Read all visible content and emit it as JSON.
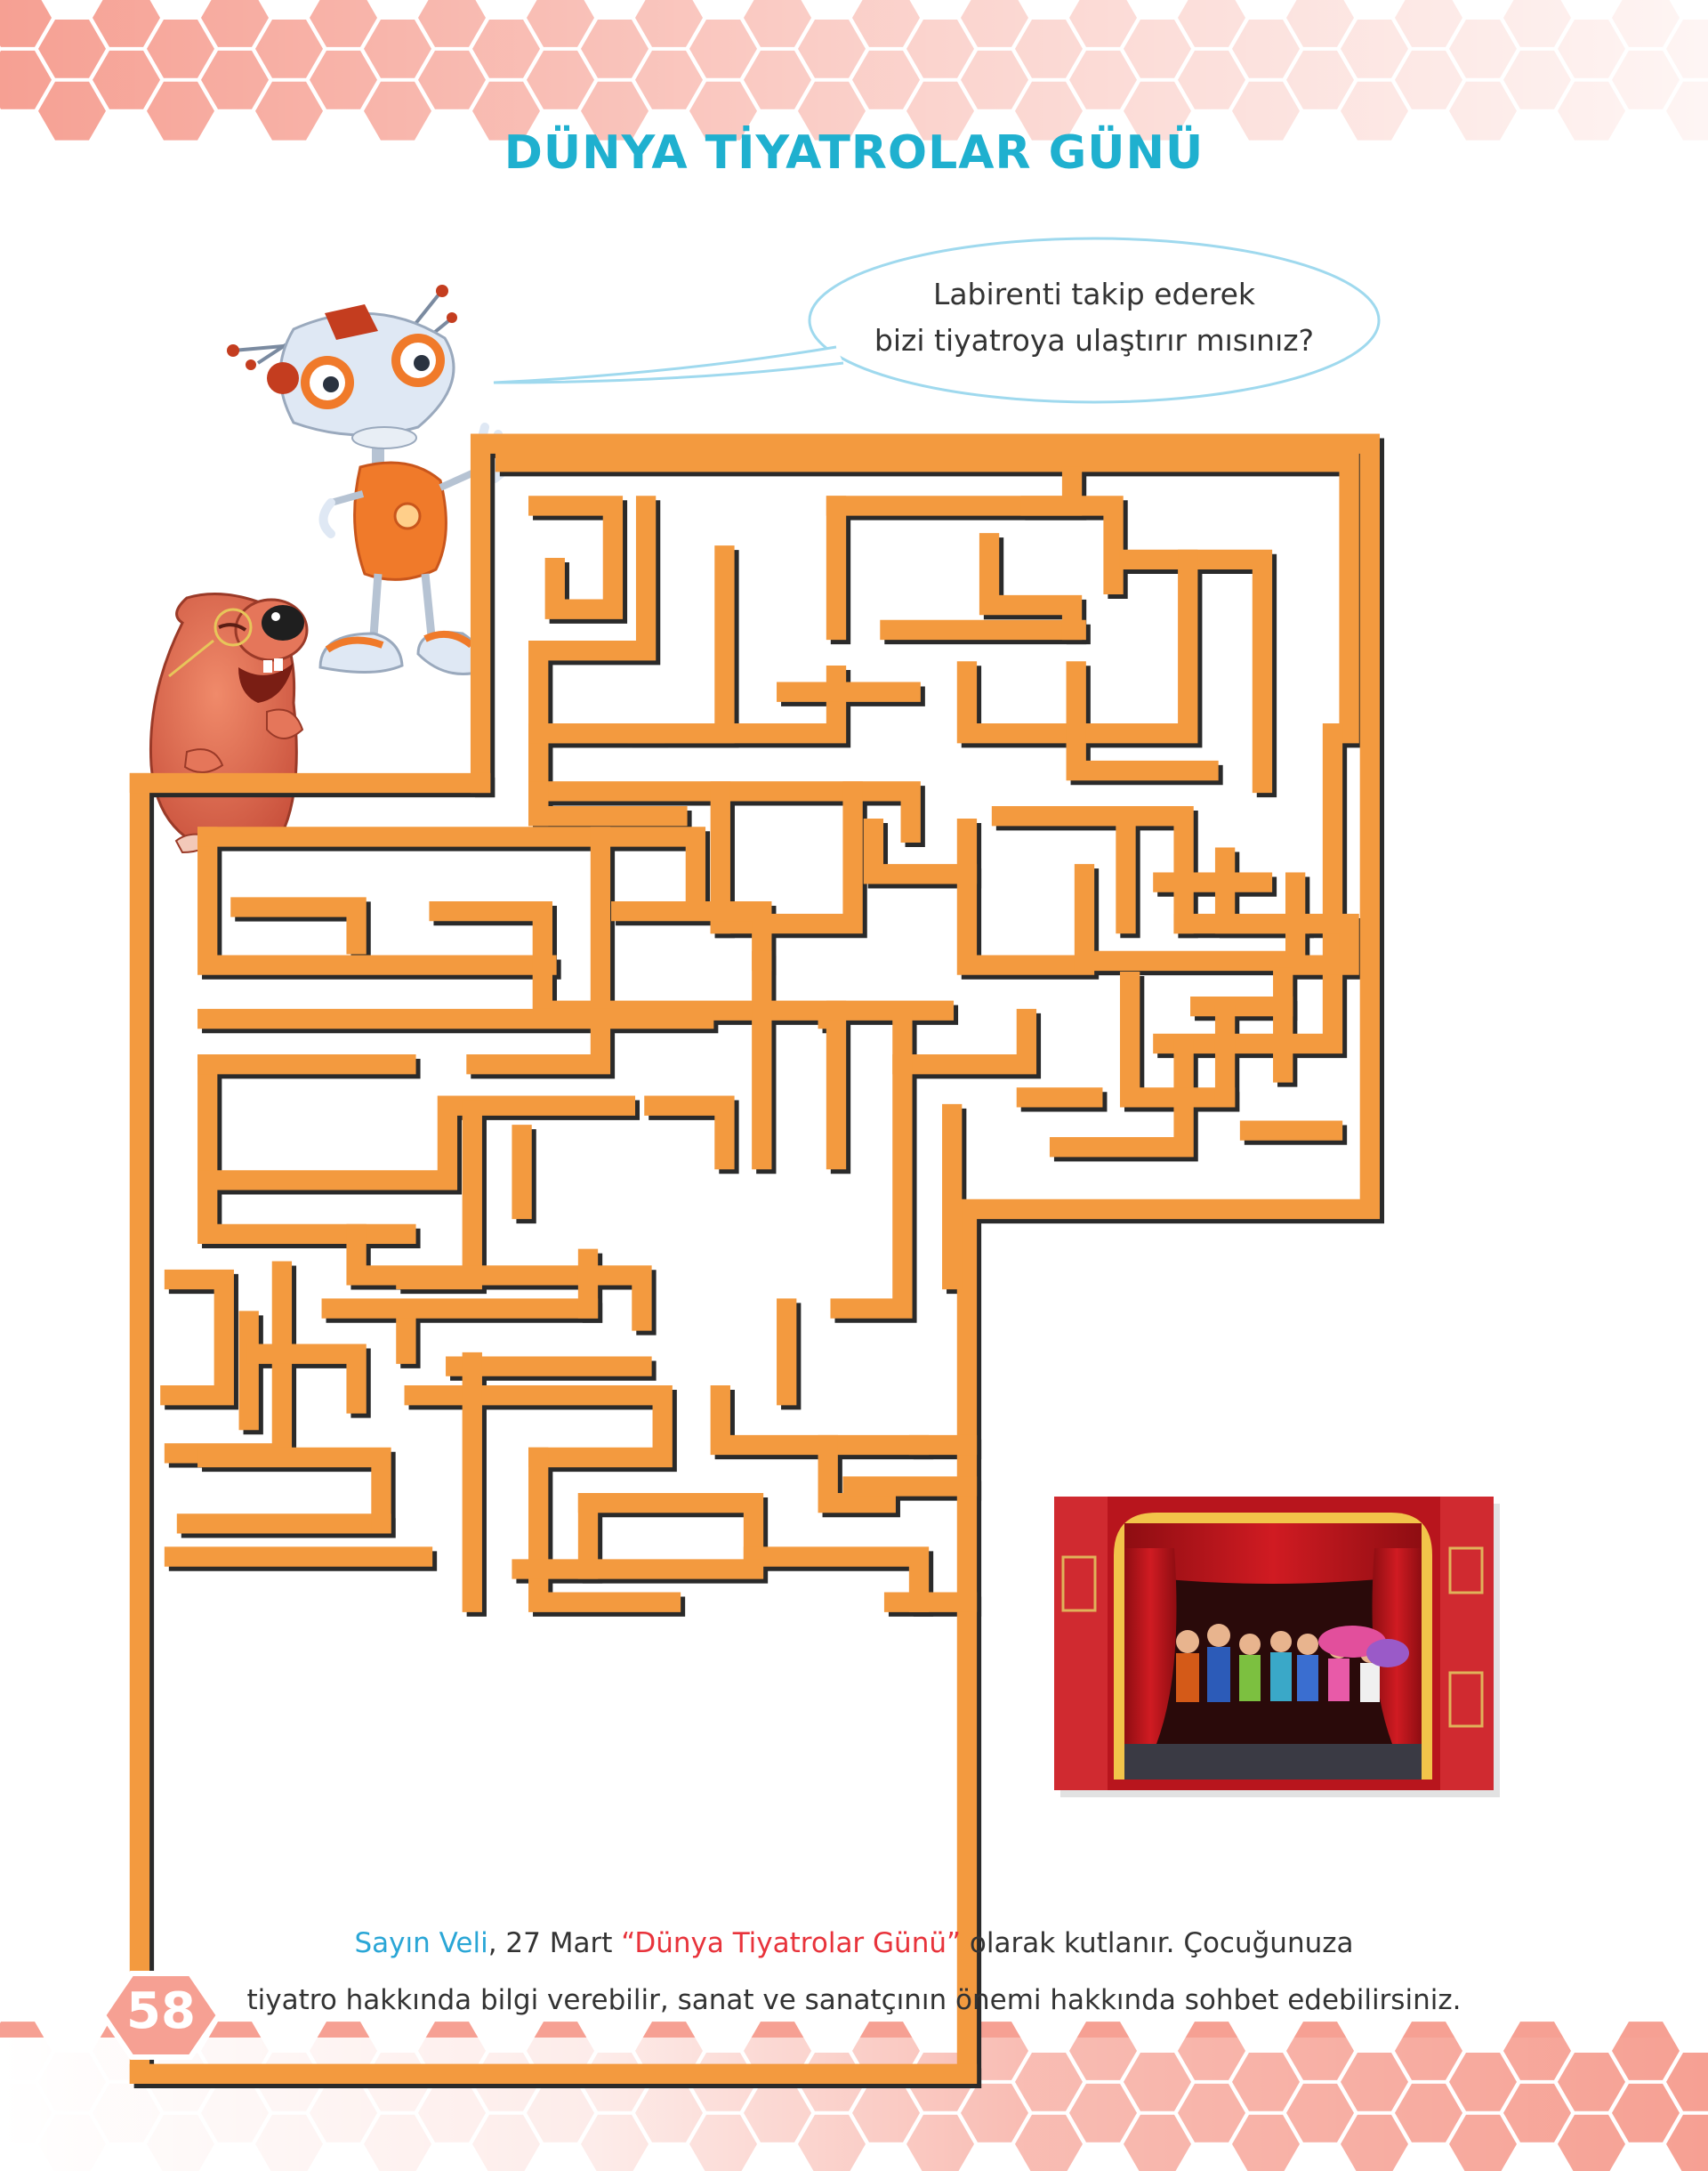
{
  "page": {
    "title": "DÜNYA TİYATROLAR GÜNÜ",
    "page_number": "58"
  },
  "speech_bubble": {
    "line1": "Labirenti takip ederek",
    "line2": "bizi tiyatroya ulaştırır mısınız?"
  },
  "parent_note": {
    "greeting": "Sayın Veli",
    "text1": ", 27 Mart ",
    "event": "“Dünya Tiyatrolar Günü”",
    "text2": " olarak kutlanır. Çocuğunuza",
    "line2": "tiyatro hakkında bilgi verebilir, sanat ve sanatçının önemi hakkında sohbet edebilirsiniz."
  },
  "colors": {
    "title": "#1fb0cf",
    "maze_wall": "#f39a3f",
    "hexagon": "#f6a093",
    "greeting": "#2aa6d6",
    "event": "#e8333b"
  },
  "icons": [
    "robot-character",
    "mole-character",
    "theater-stage-photo",
    "hexagon-pattern"
  ]
}
